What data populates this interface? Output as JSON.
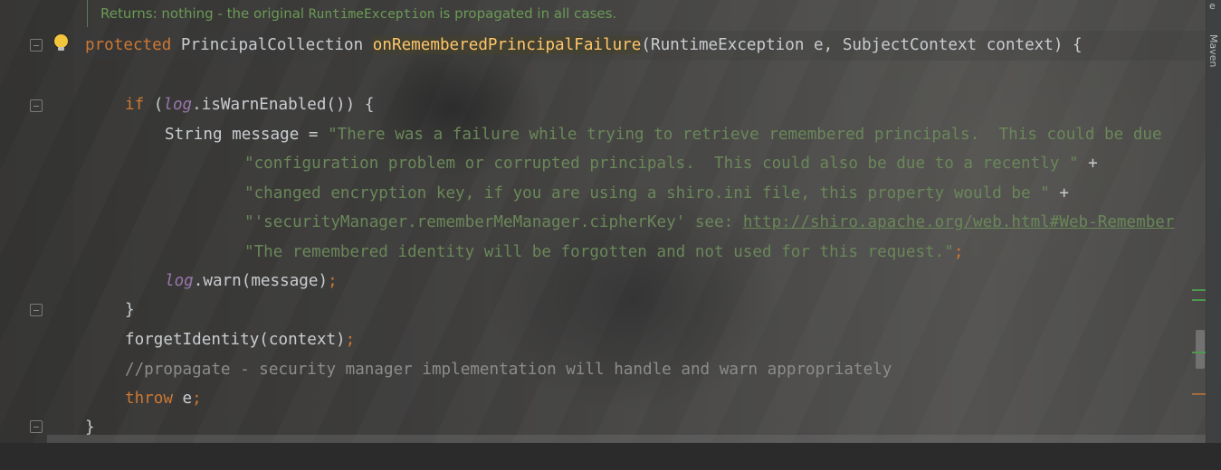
{
  "doc_comment": {
    "prefix": "Returns: nothing - the original ",
    "code": "RuntimeException",
    "suffix": " is propagated in all cases."
  },
  "sidebar": {
    "maven_label": "Maven",
    "top_label": "e"
  },
  "code": {
    "l1": {
      "kw": "protected",
      "type": " PrincipalCollection ",
      "method": "onRememberedPrincipalFailure",
      "params": "(RuntimeException e, SubjectContext context) {"
    },
    "l2": {
      "kw": "if",
      "open": " (",
      "field": "log",
      "call": ".isWarnEnabled()) {"
    },
    "l3": {
      "decl": "String message = ",
      "str": "\"There was a failure while trying to retrieve remembered principals.  This could be due "
    },
    "l4": {
      "str": "\"configuration problem or corrupted principals.  This could also be due to a recently \"",
      "op": " +"
    },
    "l5": {
      "str": "\"changed encryption key, if you are using a shiro.ini file, this property would be \"",
      "op": " +"
    },
    "l6": {
      "str": "\"'securityManager.rememberMeManager.cipherKey' see: ",
      "url": "http://shiro.apache.org/web.html#Web-Remember"
    },
    "l7": {
      "str": "\"The remembered identity will be forgotten and not used for this request.\"",
      "semi": ";"
    },
    "l8": {
      "field": "log",
      "call": ".warn(message)",
      "semi": ";"
    },
    "l9": {
      "brace": "}"
    },
    "l10": {
      "call": "forgetIdentity(context)",
      "semi": ";"
    },
    "l11": {
      "comment": "//propagate - security manager implementation will handle and warn appropriately"
    },
    "l12": {
      "kw": "throw",
      "rest": " e",
      "semi": ";"
    },
    "l13": {
      "brace": "}"
    }
  },
  "colors": {
    "keyword": "#cc7832",
    "method": "#ffc66d",
    "string": "#6a8759",
    "field": "#9876aa",
    "comment": "#8c8c8c",
    "doc": "#6a9a55"
  }
}
